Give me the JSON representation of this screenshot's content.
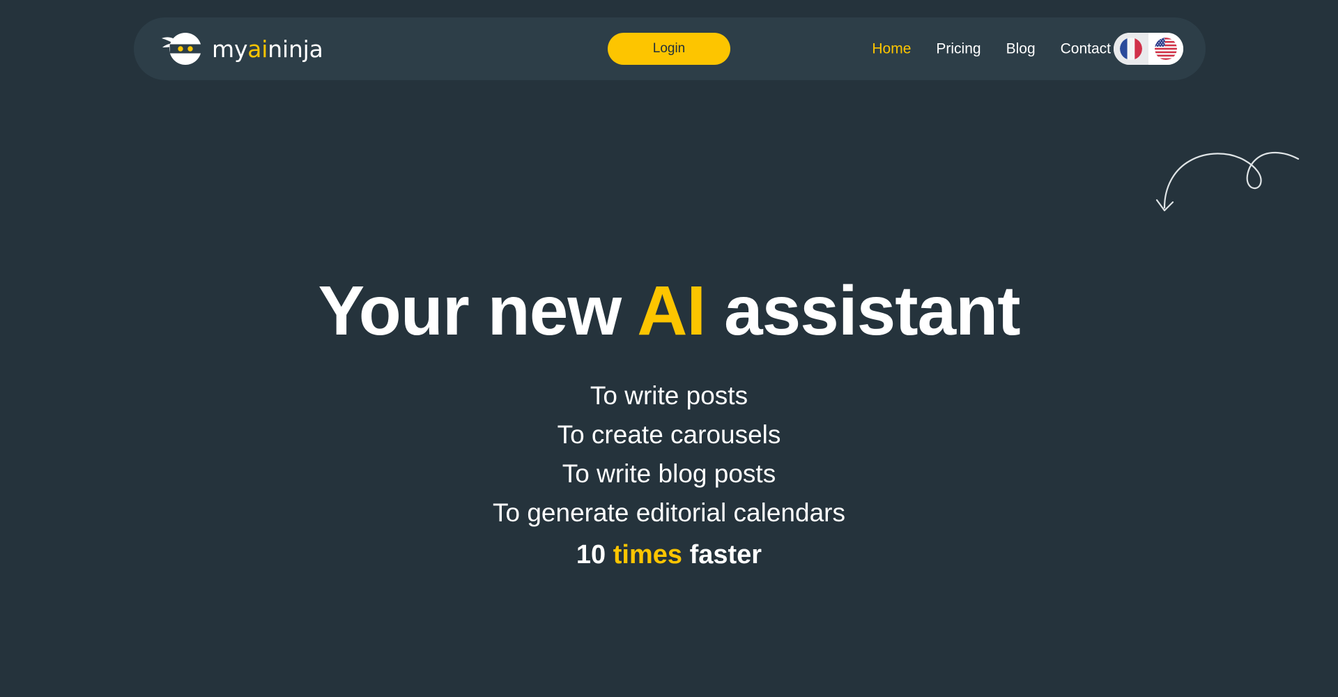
{
  "theme": {
    "page_background": "#25333c",
    "header_background": "#2d3e48",
    "accent_yellow": "#fdc500",
    "text_white": "#ffffff",
    "button_text_dark": "#22303a"
  },
  "header": {
    "logo": {
      "icon_name": "ninja-head-logo-icon",
      "wordmark_part1": "my",
      "wordmark_part2": "ai",
      "wordmark_part3": "ninja",
      "full_text": "myaininja"
    },
    "login_label": "Login",
    "nav": [
      {
        "label": "Home",
        "active": true
      },
      {
        "label": "Pricing",
        "active": false
      },
      {
        "label": "Blog",
        "active": false
      },
      {
        "label": "Contact",
        "active": false
      }
    ],
    "language_toggle": {
      "left": {
        "name": "french-flag-icon",
        "code": "FR",
        "selected": false
      },
      "right": {
        "name": "us-flag-icon",
        "code": "EN",
        "selected": true
      }
    }
  },
  "decoration": {
    "arrow_name": "curly-hand-drawn-arrow-icon",
    "arrow_color": "#dfe4e6"
  },
  "hero": {
    "title_part1": "Your new ",
    "title_accent": "AI",
    "title_part2": " assistant",
    "lines": [
      "To write posts",
      "To create carousels",
      "To write blog posts",
      "To generate editorial calendars"
    ],
    "final_line": {
      "prefix": "10 ",
      "accent": "times",
      "suffix": " faster"
    }
  }
}
